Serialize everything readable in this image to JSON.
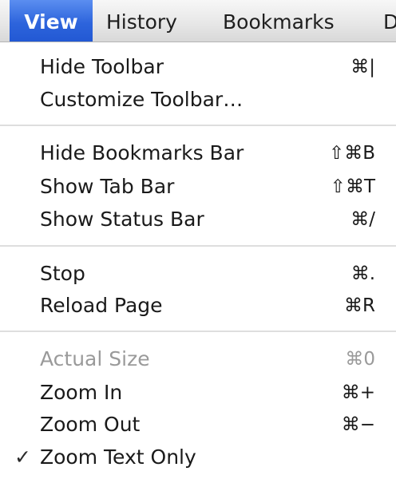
{
  "menubar": {
    "items": [
      {
        "label": "View"
      },
      {
        "label": "History"
      },
      {
        "label": "Bookmarks"
      },
      {
        "label": "D"
      }
    ]
  },
  "menu": {
    "items": [
      {
        "label": "Hide Toolbar",
        "shortcut": "⌘|"
      },
      {
        "label": "Customize Toolbar…",
        "shortcut": ""
      },
      {
        "label": "Hide Bookmarks Bar",
        "shortcut": "⇧⌘B"
      },
      {
        "label": "Show Tab Bar",
        "shortcut": "⇧⌘T"
      },
      {
        "label": "Show Status Bar",
        "shortcut": "⌘/"
      },
      {
        "label": "Stop",
        "shortcut": "⌘."
      },
      {
        "label": "Reload Page",
        "shortcut": "⌘R"
      },
      {
        "label": "Actual Size",
        "shortcut": "⌘0",
        "enabled": false
      },
      {
        "label": "Zoom In",
        "shortcut": "⌘+"
      },
      {
        "label": "Zoom Out",
        "shortcut": "⌘−"
      },
      {
        "label": "Zoom Text Only",
        "shortcut": "",
        "checked": true,
        "check_mark": "✓"
      }
    ]
  },
  "colors": {
    "highlight": "#2d64dc",
    "disabled_text": "#9a9a9a",
    "separator": "#dedede"
  }
}
